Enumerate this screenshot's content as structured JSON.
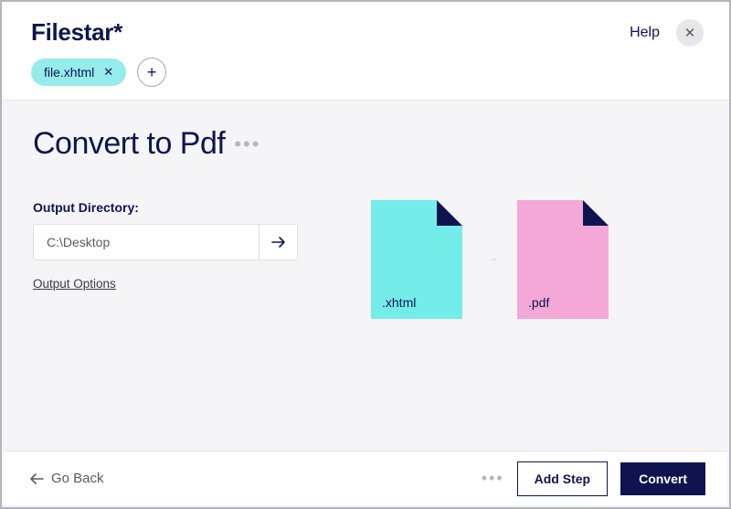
{
  "header": {
    "brand": "Filestar*",
    "help_label": "Help"
  },
  "file_chip": {
    "name": "file.xhtml"
  },
  "main": {
    "title": "Convert to Pdf",
    "output_label": "Output Directory:",
    "output_value": "C:\\Desktop",
    "options_link": "Output Options"
  },
  "diagram": {
    "src_ext": ".xhtml",
    "dst_ext": ".pdf"
  },
  "footer": {
    "back_label": "Go Back",
    "add_step_label": "Add Step",
    "convert_label": "Convert"
  }
}
